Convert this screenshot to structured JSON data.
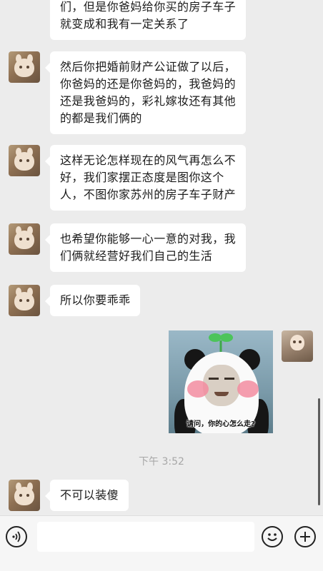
{
  "messages": [
    {
      "sender": "other",
      "lines": [
        "们，但是你爸妈给你买的房子车子",
        "就变成和我有一定关系了"
      ]
    },
    {
      "sender": "other",
      "lines": [
        "然后你把婚前财产公证做了以后，",
        "你爸妈的还是你爸妈的，我爸妈的",
        "还是我爸妈的，彩礼嫁妆还有其他",
        "的都是我们俩的"
      ]
    },
    {
      "sender": "other",
      "lines": [
        "这样无论怎样现在的风气再怎么不",
        "好，我们家摆正态度是图你这个",
        "人，不图你家苏州的房子车子财产"
      ]
    },
    {
      "sender": "other",
      "lines": [
        "也希望你能够一心一意的对我，我",
        "们俩就经营好我们自己的生活"
      ]
    },
    {
      "sender": "other",
      "lines": [
        "所以你要乖乖"
      ]
    },
    {
      "sender": "self",
      "type": "sticker",
      "caption": "请问，你的心怎么走?"
    },
    {
      "sender": "other",
      "lines": [
        "不可以装傻"
      ]
    }
  ],
  "timestamp": "下午 3:52",
  "input": {
    "value": "",
    "placeholder": ""
  },
  "icons": {
    "voice": "voice-icon",
    "emoji": "emoji-icon",
    "more": "plus-icon"
  }
}
